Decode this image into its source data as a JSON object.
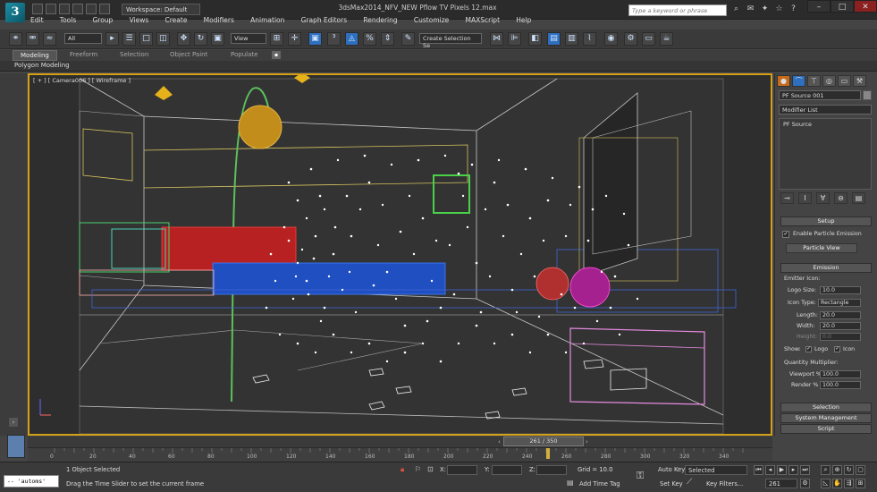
{
  "window": {
    "title": "3dsMax2014_NFV_NEW Pflow TV Pixels 12.max",
    "workspace_label": "Workspace: Default",
    "search_placeholder": "Type a keyword or phrase"
  },
  "menubar": {
    "items": [
      "Edit",
      "Tools",
      "Group",
      "Views",
      "Create",
      "Modifiers",
      "Animation",
      "Graph Editors",
      "Rendering",
      "Customize",
      "MAXScript",
      "Help"
    ]
  },
  "toolbar": {
    "selection_filter": "All",
    "ref_coord": "View",
    "named_selection": "Create Selection Se"
  },
  "ribbon": {
    "tabs": [
      "Modeling",
      "Freeform",
      "Selection",
      "Object Paint",
      "Populate"
    ],
    "active_tab": "Modeling",
    "panel_label": "Polygon Modeling"
  },
  "viewport": {
    "label": "[ + ] [ Camera006 ] [ Wireframe ]",
    "border_color": "#d4a017"
  },
  "command_panel": {
    "object_name": "PF Source 001",
    "modifier_list_label": "Modifier List",
    "stack_item": "PF Source",
    "setup": {
      "rollout_title": "Setup",
      "enable_label": "Enable Particle Emission",
      "particle_view_button": "Particle View"
    },
    "emission": {
      "rollout_title": "Emission",
      "emitter_icon_label": "Emitter Icon:",
      "logo_size_label": "Logo Size:",
      "logo_size_value": "10.0",
      "icon_type_label": "Icon Type:",
      "icon_type_value": "Rectangle",
      "length_label": "Length:",
      "length_value": "20.0",
      "width_label": "Width:",
      "width_value": "20.0",
      "height_label": "Height:",
      "height_value": "0.0",
      "show_label": "Show:",
      "show_logo": "Logo",
      "show_icon": "Icon",
      "quantity_label": "Quantity Multiplier:",
      "viewport_pct_label": "Viewport %",
      "viewport_pct_value": "100.0",
      "render_pct_label": "Render %",
      "render_pct_value": "100.0"
    },
    "collapsed_rollouts": [
      "Selection",
      "System Management",
      "Script"
    ]
  },
  "timeline": {
    "slider_text": "261 / 350",
    "current_frame": 261,
    "total_frames": 350,
    "ticks": [
      "0",
      "20",
      "40",
      "60",
      "80",
      "100",
      "120",
      "140",
      "160",
      "180",
      "200",
      "220",
      "240",
      "260",
      "280",
      "300",
      "320",
      "340"
    ]
  },
  "status": {
    "maxscript_listener": "-- 'automs'",
    "selection_text": "1 Object Selected",
    "prompt_text": "Drag the Time Slider to set the current frame",
    "x_label": "X:",
    "y_label": "Y:",
    "z_label": "Z:",
    "grid_text": "Grid = 10.0",
    "add_time_tag": "Add Time Tag",
    "auto_key": "Auto Key",
    "set_key": "Set Key",
    "key_mode": "Selected",
    "key_filters": "Key Filters...",
    "frame_field": "261"
  }
}
